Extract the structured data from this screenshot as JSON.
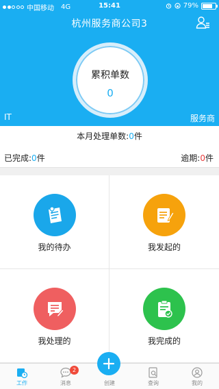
{
  "status_bar": {
    "carrier": "中国移动",
    "network": "4G",
    "time": "15:41",
    "battery": "79%",
    "battery_level": 0.79
  },
  "header": {
    "title": "杭州服务商公司3",
    "circle_label": "累积单数",
    "circle_value": "0",
    "left_tag": "IT",
    "right_tag": "服务商",
    "bg_color": "#1aaef2"
  },
  "summary": {
    "month_label": "本月处理单数:",
    "month_count": "0",
    "month_unit": "件",
    "done_label": "已完成:",
    "done_count": "0",
    "done_unit": "件",
    "overdue_label": "逾期:",
    "overdue_count": "0",
    "overdue_unit": "件"
  },
  "grid": [
    {
      "label": "我的待办",
      "icon": "clipboard-pin-icon",
      "color": "#1aa7ea"
    },
    {
      "label": "我发起的",
      "icon": "edit-list-icon",
      "color": "#f6a20c"
    },
    {
      "label": "我处理的",
      "icon": "chat-pencil-icon",
      "color": "#ef5f60"
    },
    {
      "label": "我完成的",
      "icon": "clipboard-check-icon",
      "color": "#2dc24d"
    }
  ],
  "tabs": [
    {
      "label": "工作",
      "icon": "work-icon"
    },
    {
      "label": "消息",
      "icon": "message-icon",
      "badge": "2"
    },
    {
      "label": "创建",
      "icon": "plus-icon"
    },
    {
      "label": "查询",
      "icon": "search-doc-icon"
    },
    {
      "label": "我的",
      "icon": "user-icon"
    }
  ]
}
